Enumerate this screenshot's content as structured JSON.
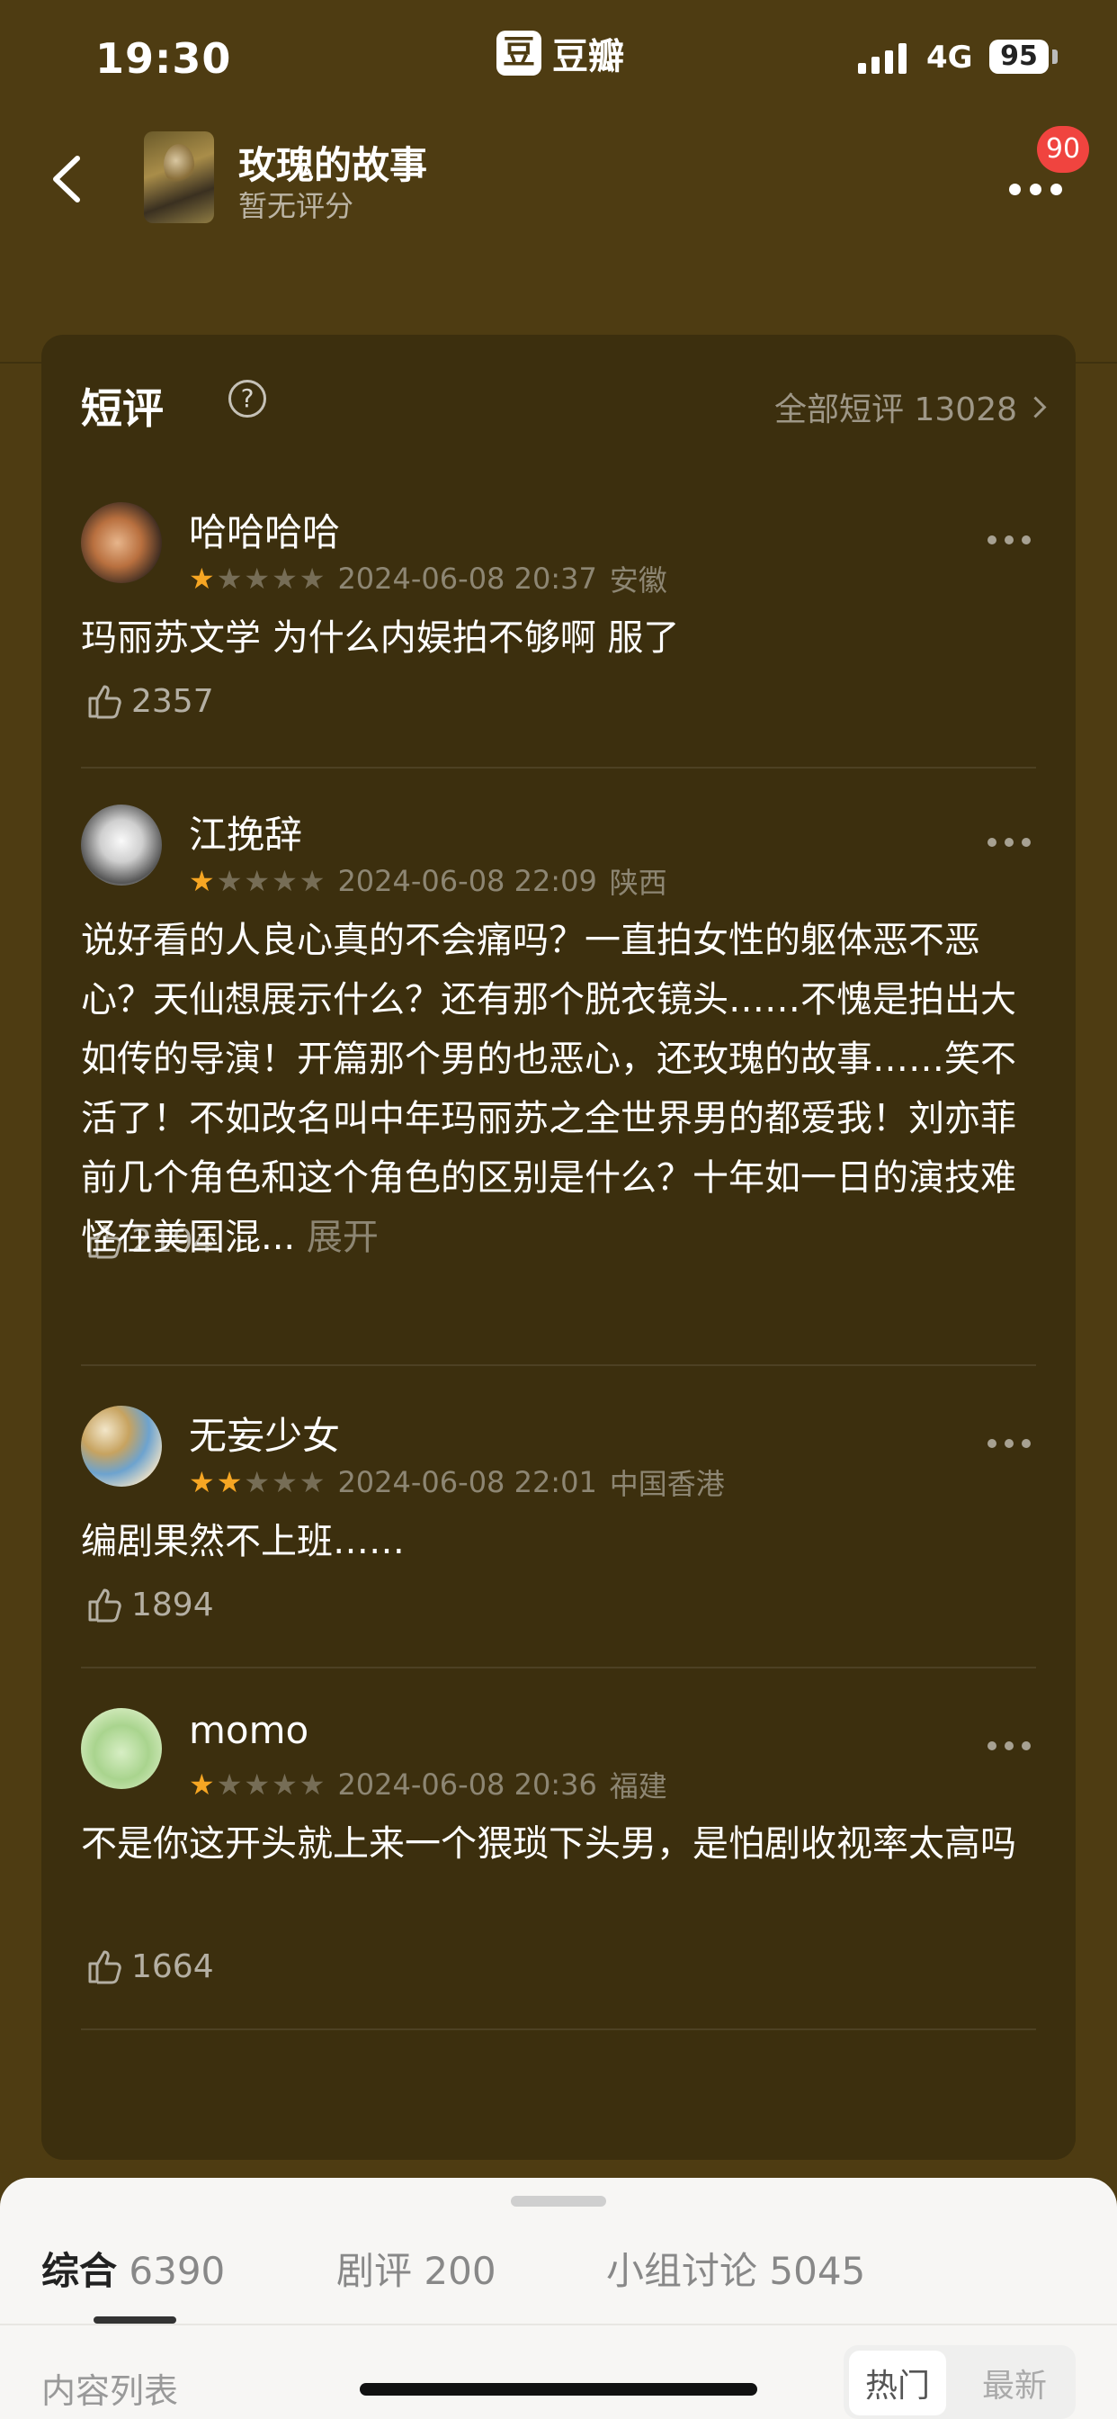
{
  "status_bar": {
    "time": "19:30",
    "brand": "豆瓣",
    "brand_logo": "豆",
    "network": "4G",
    "battery": "95"
  },
  "nav": {
    "title": "玫瑰的故事",
    "subtitle": "暂无评分",
    "notification_count": "90"
  },
  "reviews": {
    "heading": "短评",
    "all_link": "全部短评 13028",
    "items": [
      {
        "user": "哈哈哈哈",
        "rating": 1,
        "date": "2024-06-08 20:37",
        "location": "安徽",
        "text": "玛丽苏文学 为什么内娱拍不够啊 服了",
        "expand": "",
        "likes": "2357"
      },
      {
        "user": "江挽辞",
        "rating": 1,
        "date": "2024-06-08 22:09",
        "location": "陕西",
        "text": "说好看的人良心真的不会痛吗？一直拍女性的躯体恶不恶心？天仙想展示什么？还有那个脱衣镜头……不愧是拍出大如传的导演！开篇那个男的也恶心，还玫瑰的故事……笑不活了！不如改名叫中年玛丽苏之全世界男的都爱我！刘亦菲前几个角色和这个角色的区别是什么？十年如一日的演技难怪在美国混...",
        "expand": "展开",
        "likes": "2194"
      },
      {
        "user": "无妄少女",
        "rating": 2,
        "date": "2024-06-08 22:01",
        "location": "中国香港",
        "text": "编剧果然不上班……",
        "expand": "",
        "likes": "1894"
      },
      {
        "user": "momo",
        "rating": 1,
        "date": "2024-06-08 20:36",
        "location": "福建",
        "text": "不是你这开头就上来一个猥琐下头男，是怕剧收视率太高吗",
        "expand": "",
        "likes": "1664"
      }
    ]
  },
  "bottom_sheet": {
    "tabs": [
      {
        "label": "综合",
        "count": "6390",
        "active": true
      },
      {
        "label": "剧评",
        "count": "200",
        "active": false
      },
      {
        "label": "小组讨论",
        "count": "5045",
        "active": false
      }
    ],
    "list_label": "内容列表",
    "sort_options": [
      "热门",
      "最新"
    ]
  },
  "colors": {
    "background": "#4e3c12",
    "card": "#3c2f0e",
    "star": "#f6a623",
    "badge": "#f0443f"
  }
}
